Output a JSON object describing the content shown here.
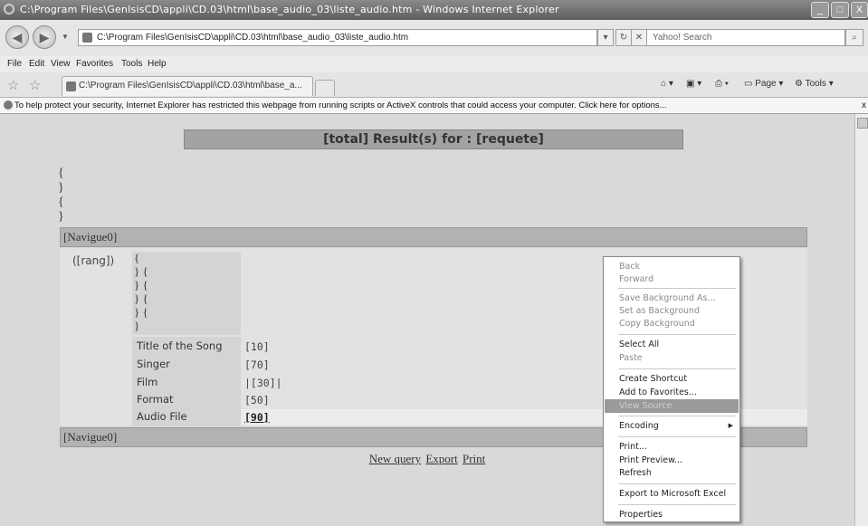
{
  "window": {
    "title": "C:\\Program Files\\GenIsisCD\\appli\\CD.03\\html\\base_audio_03\\liste_audio.htm - Windows Internet Explorer",
    "min": "_",
    "max": "□",
    "close": "X"
  },
  "address": {
    "url": "C:\\Program Files\\GenIsisCD\\appli\\CD.03\\html\\base_audio_03\\liste_audio.htm",
    "search_placeholder": "Yahoo! Search"
  },
  "menu": [
    "File",
    "Edit",
    "View",
    "Favorites",
    "Tools",
    "Help"
  ],
  "tab": {
    "title": "C:\\Program Files\\GenIsisCD\\appli\\CD.03\\html\\base_a...",
    "page_label": "Page",
    "tools_label": "Tools"
  },
  "infobar": {
    "text": "To help protect your security, Internet Explorer has restricted this webpage from running scripts or ActiveX controls that could access your computer. Click here for options...",
    "close": "x"
  },
  "content": {
    "header": "[total] Result(s) for : [requete]",
    "top_braces": [
      "{",
      "}",
      "{",
      "}"
    ],
    "navigue_top": "[Navigue0]",
    "navigue_bottom": "[Navigue0]",
    "rang": "([rang])",
    "brace_lines": [
      "{",
      "} {",
      "} {",
      "} {",
      "} {",
      "}"
    ],
    "fields": [
      {
        "label": "Title of the Song",
        "value": "[10]"
      },
      {
        "label": "Singer",
        "value": "[70]"
      },
      {
        "label": "Film",
        "value": "|[30]|"
      },
      {
        "label": "Format",
        "value": "[50]"
      },
      {
        "label": "Audio File",
        "value": "[90]"
      }
    ],
    "links": {
      "new_query": "New query",
      "export": "Export",
      "print": "Print"
    }
  },
  "context_menu": {
    "back": "Back",
    "forward": "Forward",
    "save_bg": "Save Background As...",
    "set_bg": "Set as Background",
    "copy_bg": "Copy Background",
    "select_all": "Select All",
    "paste": "Paste",
    "create_shortcut": "Create Shortcut",
    "add_favorites": "Add to Favorites...",
    "view_source": "View Source",
    "encoding": "Encoding",
    "print": "Print...",
    "print_preview": "Print Preview...",
    "refresh": "Refresh",
    "export_excel": "Export to Microsoft Excel",
    "properties": "Properties"
  }
}
